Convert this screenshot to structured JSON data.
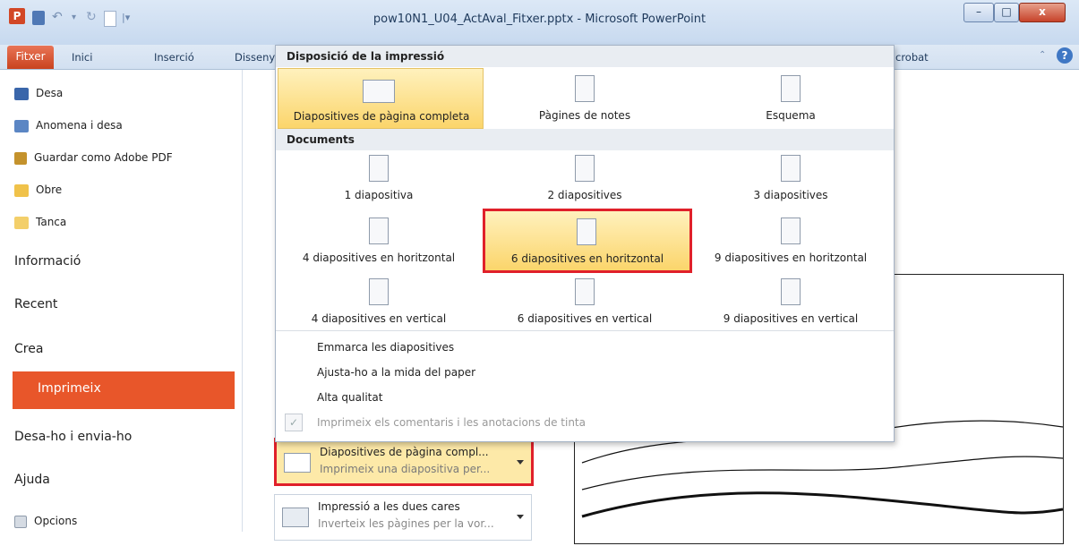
{
  "window": {
    "title": "pow10N1_U04_ActAval_Fitxer.pptx - Microsoft PowerPoint",
    "app_letter": "P",
    "minimize": "–",
    "maximize": "□",
    "close": "x"
  },
  "ribbon": {
    "tabs": [
      "Fitxer",
      "Inici",
      "Inserció",
      "Disseny",
      "crobat"
    ],
    "help": "?"
  },
  "nav": {
    "commands": [
      "Desa",
      "Anomena i desa",
      "Guardar como Adobe PDF",
      "Obre",
      "Tanca"
    ],
    "sections": [
      "Informació",
      "Recent",
      "Crea",
      "Imprimeix",
      "Desa-ho i envia-ho",
      "Ajuda"
    ],
    "options": "Opcions"
  },
  "dropdown": {
    "section1": "Disposició de la impressió",
    "print_layouts": [
      "Diapositives de pàgina completa",
      "Pàgines de notes",
      "Esquema"
    ],
    "section2": "Documents",
    "handouts": [
      "1 diapositiva",
      "2 diapositives",
      "3 diapositives",
      "4 diapositives en horitzontal",
      "6 diapositives en horitzontal",
      "9 diapositives en horitzontal",
      "4 diapositives en vertical",
      "6 diapositives en vertical",
      "9 diapositives en vertical"
    ],
    "commands": {
      "frame": "Emmarca les diapositives",
      "fit": "Ajusta-ho a la mida del paper",
      "quality": "Alta qualitat",
      "comments": "Imprimeix els comentaris i les anotacions de tinta"
    }
  },
  "selectors": {
    "layout_line1": "Diapositives de pàgina compl...",
    "layout_line2": "Imprimeix una diapositiva per...",
    "duplex_line1": "Impressió a les dues cares",
    "duplex_line2": "Inverteix les pàgines per la vor..."
  },
  "colors": {
    "accent": "#e8562a",
    "highlight": "#fbd56b",
    "annotation": "#e0202a"
  }
}
